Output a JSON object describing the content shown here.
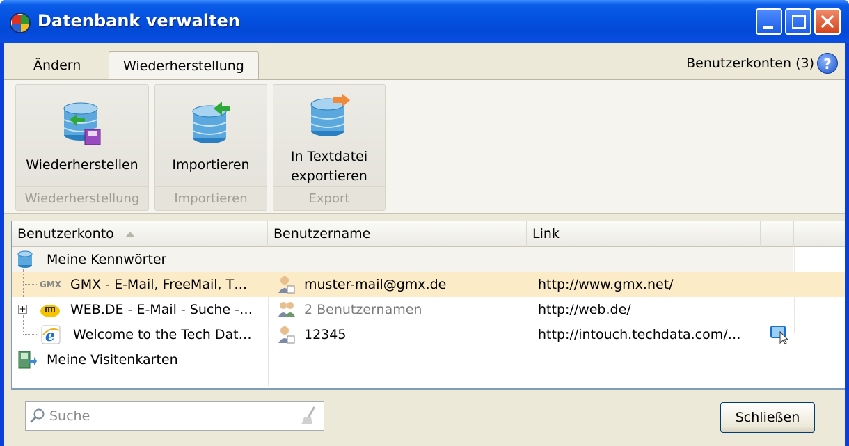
{
  "window": {
    "title": "Datenbank verwalten"
  },
  "tabs": [
    {
      "label": "Ändern",
      "active": false
    },
    {
      "label": "Wiederherstellung",
      "active": true
    }
  ],
  "header": {
    "accounts_count": "Benutzerkonten (3)",
    "help_icon": "help-icon"
  },
  "ribbon": {
    "groups": [
      {
        "button_label": "Wiederherstellen",
        "group_label": "Wiederherstellung",
        "icon": "database-restore-icon"
      },
      {
        "button_label": "Importieren",
        "group_label": "Importieren",
        "icon": "database-import-icon"
      },
      {
        "button_label_line1": "In Textdatei",
        "button_label_line2": "exportieren",
        "group_label": "Export",
        "icon": "database-export-icon"
      }
    ]
  },
  "list": {
    "columns": [
      "Benutzerkonto",
      "Benutzername",
      "Link"
    ],
    "groups": [
      {
        "name": "Meine Kennwörter",
        "icon": "database-icon",
        "items": [
          {
            "account": "GMX - E-Mail, FreeMail, T…",
            "username": "muster-mail@gmx.de",
            "link": "http://www.gmx.net/",
            "icon": "gmx-icon",
            "selected": true
          },
          {
            "account": "WEB.DE - E-Mail - Suche -…",
            "username": "2 Benutzernamen",
            "link": "http://web.de/",
            "icon": "webde-icon",
            "expandable": true,
            "muted_username": true
          },
          {
            "account": "Welcome to the Tech Dat…",
            "username": "12345",
            "link": "http://intouch.techdata.com/…",
            "icon": "ie-icon",
            "has_open_action": true
          }
        ]
      },
      {
        "name": "Meine Visitenkarten",
        "icon": "business-card-icon"
      }
    ]
  },
  "footer": {
    "search_placeholder": "Suche",
    "close_button": "Schließen"
  },
  "colors": {
    "titlebar": "#0552e0",
    "selected_row": "#fbebc6",
    "client_bg": "#ece9d8"
  }
}
